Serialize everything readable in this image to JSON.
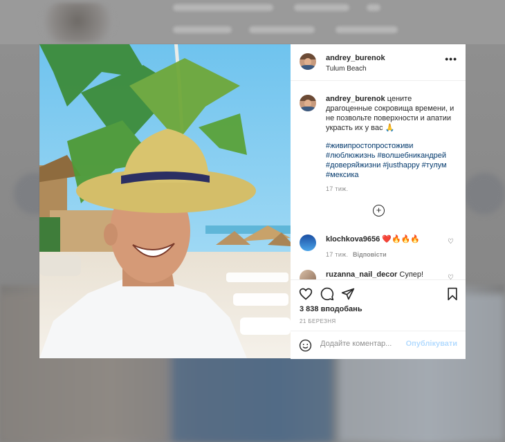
{
  "background": {
    "nav_items": [
      "andrey_burenok",
      "Подписаться",
      "..."
    ]
  },
  "post": {
    "username": "andrey_burenok",
    "location": "Tulum Beach",
    "more_icon": "more-horizontal-icon",
    "caption_text": "цените драгоценные сокровища времени, и не позвольте поверхности и апатии украсть их у вас 🙏",
    "hashtags": "#живипростопростоживи #люблюжизнь #волшебникандрей #доверяйжизни #justhappy #тулум #мексика",
    "caption_time": "17 тиж.",
    "load_more_icon": "plus-circle-icon",
    "comments": [
      {
        "username": "klochkova9656",
        "text": "❤️🔥🔥🔥",
        "time": "17 тиж.",
        "reply": "Відповісти"
      },
      {
        "username": "ruzanna_nail_decor",
        "text": "Супер!"
      }
    ],
    "likes": "3 838 вподобань",
    "date": "21 БЕРЕЗНЯ",
    "comment_placeholder": "Додайте коментар...",
    "publish_label": "Опублікувати"
  },
  "colors": {
    "link": "#00376b",
    "muted": "#8e8e8e",
    "publish_disabled": "#b3dbff"
  }
}
